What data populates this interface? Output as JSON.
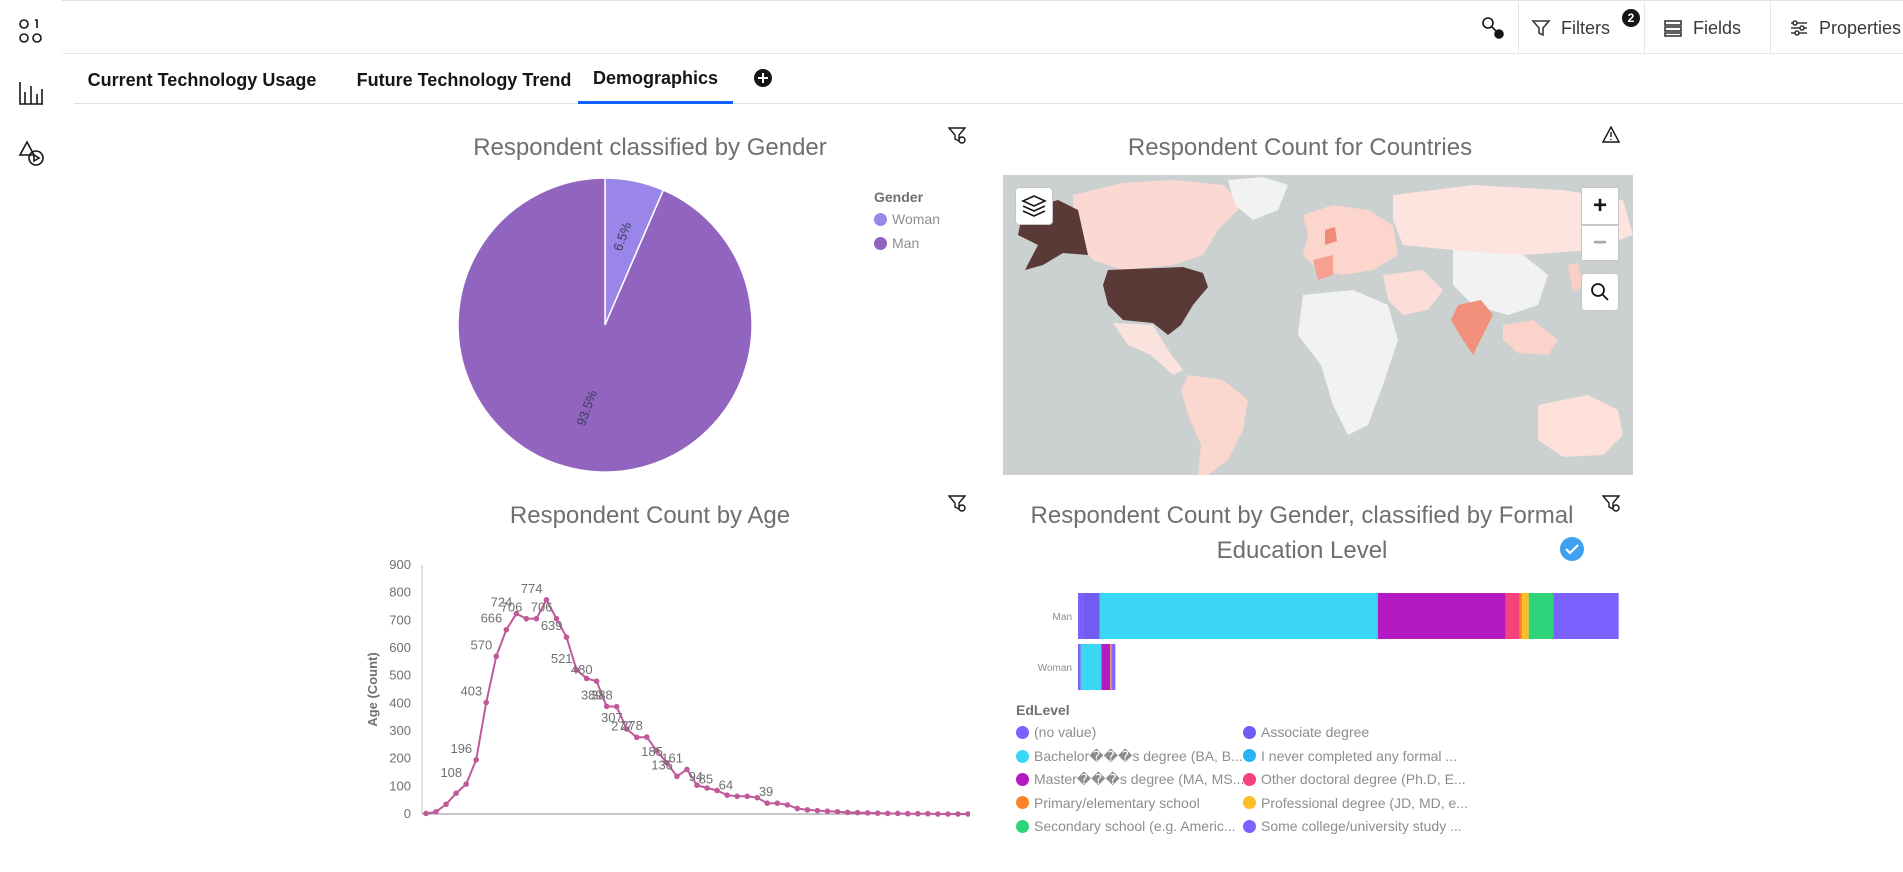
{
  "topbar": {
    "filters_label": "Filters",
    "filters_count": "2",
    "fields_label": "Fields",
    "properties_label": "Properties"
  },
  "tabs": [
    {
      "label": "Current Technology Usage"
    },
    {
      "label": "Future Technology Trend"
    },
    {
      "label": "Demographics"
    }
  ],
  "gender_pie": {
    "title": "Respondent classified by Gender",
    "legend_title": "Gender",
    "legend": [
      {
        "label": "Woman",
        "color": "#9a86e8"
      },
      {
        "label": "Man",
        "color": "#9165bf"
      }
    ],
    "slice_labels": [
      "6.5%",
      "93.5%"
    ]
  },
  "country_map": {
    "title": "Respondent Count for Countries",
    "zoom_in": "+",
    "zoom_out": "−"
  },
  "age_chart": {
    "title": "Respondent Count by Age",
    "ylabel": "Age (Count)",
    "yticks": [
      "900",
      "800",
      "700",
      "600",
      "500",
      "400",
      "300",
      "200",
      "100",
      "0"
    ]
  },
  "edu_chart": {
    "title_line1": "Respondent Count by Gender, classified by Formal",
    "title_line2": "Education Level",
    "categories": [
      "Man",
      "Woman"
    ],
    "legend_title": "EdLevel",
    "legend": [
      {
        "label": "(no value)",
        "color": "#7b61ff"
      },
      {
        "label": "Associate degree",
        "color": "#6f5cf2"
      },
      {
        "label": "Bachelor���s degree (BA, B...",
        "color": "#3cd6f5"
      },
      {
        "label": "I never completed any formal ...",
        "color": "#28b5f5"
      },
      {
        "label": "Master���s degree (MA, MS...",
        "color": "#b519c1"
      },
      {
        "label": "Other doctoral degree (Ph.D, E...",
        "color": "#f5417c"
      },
      {
        "label": "Primary/elementary school",
        "color": "#ff832b"
      },
      {
        "label": "Professional degree (JD, MD, e...",
        "color": "#fbbf24"
      },
      {
        "label": "Secondary school (e.g. Americ...",
        "color": "#2ed47a"
      },
      {
        "label": "Some college/university study ...",
        "color": "#7b61ff"
      }
    ]
  },
  "chart_data": [
    {
      "type": "pie",
      "title": "Respondent classified by Gender",
      "categories": [
        "Woman",
        "Man"
      ],
      "values": [
        6.5,
        93.5
      ],
      "colors": [
        "#9a86e8",
        "#9165bf"
      ],
      "legend_position": "right"
    },
    {
      "type": "line",
      "title": "Respondent Count by Age",
      "ylabel": "Age (Count)",
      "ylim": [
        0,
        900
      ],
      "color": "#c05a9a",
      "values": [
        2,
        8,
        35,
        75,
        108,
        196,
        403,
        570,
        666,
        724,
        706,
        706,
        774,
        706,
        639,
        521,
        490,
        480,
        389,
        388,
        307,
        277,
        278,
        228,
        185,
        136,
        161,
        104,
        94,
        85,
        68,
        64,
        64,
        59,
        39,
        39,
        33,
        20,
        15,
        12,
        10,
        8,
        6,
        5,
        4,
        3,
        2,
        2,
        1,
        1,
        1,
        0,
        0,
        0,
        0
      ],
      "labels": [
        {
          "i": 4,
          "text": "108"
        },
        {
          "i": 5,
          "text": "196"
        },
        {
          "i": 6,
          "text": "403"
        },
        {
          "i": 7,
          "text": "570"
        },
        {
          "i": 8,
          "text": "666"
        },
        {
          "i": 9,
          "text": "724"
        },
        {
          "i": 10,
          "text": "706"
        },
        {
          "i": 12,
          "text": "774"
        },
        {
          "i": 13,
          "text": "706"
        },
        {
          "i": 14,
          "text": "639"
        },
        {
          "i": 15,
          "text": "521"
        },
        {
          "i": 17,
          "text": "480"
        },
        {
          "i": 18,
          "text": "389"
        },
        {
          "i": 19,
          "text": "388"
        },
        {
          "i": 20,
          "text": "307"
        },
        {
          "i": 21,
          "text": "277"
        },
        {
          "i": 22,
          "text": "278"
        },
        {
          "i": 24,
          "text": "185"
        },
        {
          "i": 25,
          "text": "136"
        },
        {
          "i": 26,
          "text": "161"
        },
        {
          "i": 28,
          "text": "94"
        },
        {
          "i": 29,
          "text": "85"
        },
        {
          "i": 31,
          "text": "64"
        },
        {
          "i": 35,
          "text": "39"
        }
      ]
    },
    {
      "type": "bar",
      "orientation": "horizontal",
      "stacked": true,
      "title": "Respondent Count by Gender, classified by Formal Education Level",
      "categories": [
        "Man",
        "Woman"
      ],
      "series": [
        {
          "name": "(no value)",
          "color": "#7b61ff",
          "values": [
            1.0,
            0.2
          ]
        },
        {
          "name": "Associate degree",
          "color": "#6f5cf2",
          "values": [
            3.0,
            0.3
          ]
        },
        {
          "name": "Bachelor���s degree (BA, B...",
          "color": "#3cd6f5",
          "values": [
            51.0,
            3.8
          ]
        },
        {
          "name": "Master���s degree (MA, MS...",
          "color": "#b519c1",
          "values": [
            23.5,
            1.6
          ]
        },
        {
          "name": "Other doctoral degree (Ph.D, E...",
          "color": "#f5417c",
          "values": [
            2.5,
            0.1
          ]
        },
        {
          "name": "Primary/elementary school",
          "color": "#ff832b",
          "values": [
            0.5,
            0.0
          ]
        },
        {
          "name": "Professional degree (JD, MD, e...",
          "color": "#fbbf24",
          "values": [
            1.2,
            0.05
          ]
        },
        {
          "name": "Secondary school (e.g. Americ...",
          "color": "#2ed47a",
          "values": [
            4.5,
            0.2
          ]
        },
        {
          "name": "Some college/university study ...",
          "color": "#7b61ff",
          "values": [
            12.0,
            0.6
          ]
        }
      ],
      "xlim": [
        0,
        100
      ]
    }
  ]
}
